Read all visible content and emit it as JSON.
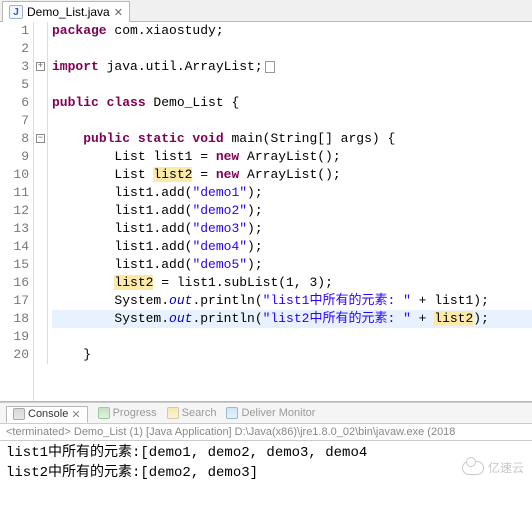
{
  "tab": {
    "filename": "Demo_List.java"
  },
  "source": {
    "lines": [
      {
        "n": 1,
        "tokens": [
          [
            "kw",
            "package"
          ],
          [
            "",
            " com.xiaostudy;"
          ]
        ]
      },
      {
        "n": 2,
        "tokens": []
      },
      {
        "n": 3,
        "fold": "+",
        "tokens": [
          [
            "kw",
            "import"
          ],
          [
            "",
            " java.util.ArrayList;"
          ],
          [
            "box",
            ""
          ]
        ]
      },
      {
        "n": 5,
        "tokens": []
      },
      {
        "n": 6,
        "tokens": [
          [
            "kw",
            "public class"
          ],
          [
            "",
            " Demo_List {"
          ]
        ]
      },
      {
        "n": 7,
        "tokens": []
      },
      {
        "n": 8,
        "fold": "-",
        "marker": true,
        "tokens": [
          [
            "",
            "    "
          ],
          [
            "kw",
            "public static void"
          ],
          [
            "",
            " main(String[] args) {"
          ]
        ]
      },
      {
        "n": 9,
        "marker": true,
        "tokens": [
          [
            "",
            "        List list1 = "
          ],
          [
            "kw",
            "new"
          ],
          [
            "",
            " ArrayList();"
          ]
        ]
      },
      {
        "n": 10,
        "marker": true,
        "tokens": [
          [
            "",
            "        List "
          ],
          [
            "hl",
            "list2"
          ],
          [
            "",
            " = "
          ],
          [
            "kw",
            "new"
          ],
          [
            "",
            " ArrayList();"
          ]
        ]
      },
      {
        "n": 11,
        "marker": true,
        "tokens": [
          [
            "",
            "        list1.add("
          ],
          [
            "str",
            "\"demo1\""
          ],
          [
            "",
            ");"
          ]
        ]
      },
      {
        "n": 12,
        "marker": true,
        "tokens": [
          [
            "",
            "        list1.add("
          ],
          [
            "str",
            "\"demo2\""
          ],
          [
            "",
            ");"
          ]
        ]
      },
      {
        "n": 13,
        "marker": true,
        "tokens": [
          [
            "",
            "        list1.add("
          ],
          [
            "str",
            "\"demo3\""
          ],
          [
            "",
            ");"
          ]
        ]
      },
      {
        "n": 14,
        "marker": true,
        "tokens": [
          [
            "",
            "        list1.add("
          ],
          [
            "str",
            "\"demo4\""
          ],
          [
            "",
            ");"
          ]
        ]
      },
      {
        "n": 15,
        "marker": true,
        "tokens": [
          [
            "",
            "        list1.add("
          ],
          [
            "str",
            "\"demo5\""
          ],
          [
            "",
            ");"
          ]
        ]
      },
      {
        "n": 16,
        "marker": true,
        "tokens": [
          [
            "",
            "        "
          ],
          [
            "hl",
            "list2"
          ],
          [
            "",
            " = list1.subList(1, 3);"
          ]
        ]
      },
      {
        "n": 17,
        "marker": true,
        "tokens": [
          [
            "",
            "        System."
          ],
          [
            "it",
            "out"
          ],
          [
            "",
            ".println("
          ],
          [
            "str",
            "\"list1中所有的元素: \""
          ],
          [
            "",
            " + list1);"
          ]
        ]
      },
      {
        "n": 18,
        "marker": true,
        "current": true,
        "tokens": [
          [
            "",
            "        System."
          ],
          [
            "it",
            "out"
          ],
          [
            "",
            ".println("
          ],
          [
            "str",
            "\"list2中所有的元素: \""
          ],
          [
            "",
            " + "
          ],
          [
            "hl",
            "list2"
          ],
          [
            "",
            ");"
          ]
        ]
      },
      {
        "n": 19,
        "tokens": []
      },
      {
        "n": 20,
        "tokens": [
          [
            "",
            "    }"
          ]
        ]
      }
    ]
  },
  "consoleTabs": {
    "console": "Console",
    "progress": "Progress",
    "search": "Search",
    "deliver": "Deliver Monitor"
  },
  "consoleHeader": "<terminated> Demo_List (1) [Java Application] D:\\Java(x86)\\jre1.8.0_02\\bin\\javaw.exe (2018",
  "consoleOutput": [
    "list1中所有的元素:[demo1, demo2, demo3, demo4",
    "list2中所有的元素:[demo2, demo3]"
  ],
  "watermark": "亿速云"
}
